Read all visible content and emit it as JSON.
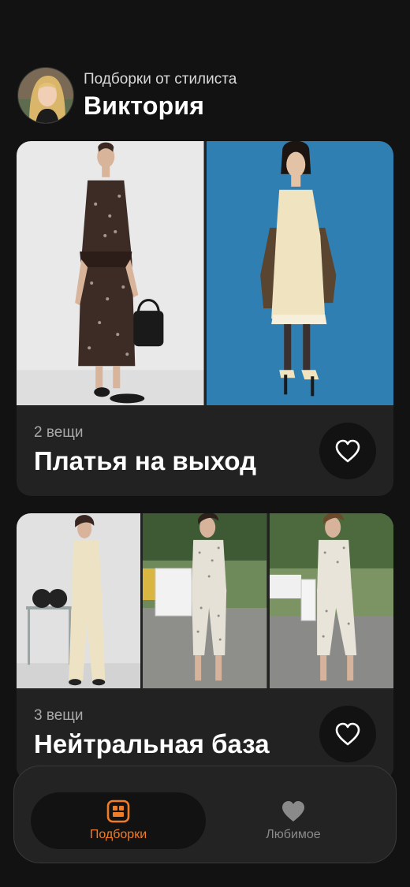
{
  "stylist": {
    "subtitle": "Подборки от стилиста",
    "name": "Виктория"
  },
  "collections": [
    {
      "count": "2 вещи",
      "title": "Платья на выход"
    },
    {
      "count": "3 вещи",
      "title": "Нейтральная база"
    }
  ],
  "tabs": [
    {
      "label": "Подборки",
      "icon": "collections-icon",
      "active": true
    },
    {
      "label": "Любимое",
      "icon": "heart-icon",
      "active": false
    }
  ],
  "colors": {
    "accent": "#f07c28",
    "background": "#121212",
    "card": "#222222"
  }
}
